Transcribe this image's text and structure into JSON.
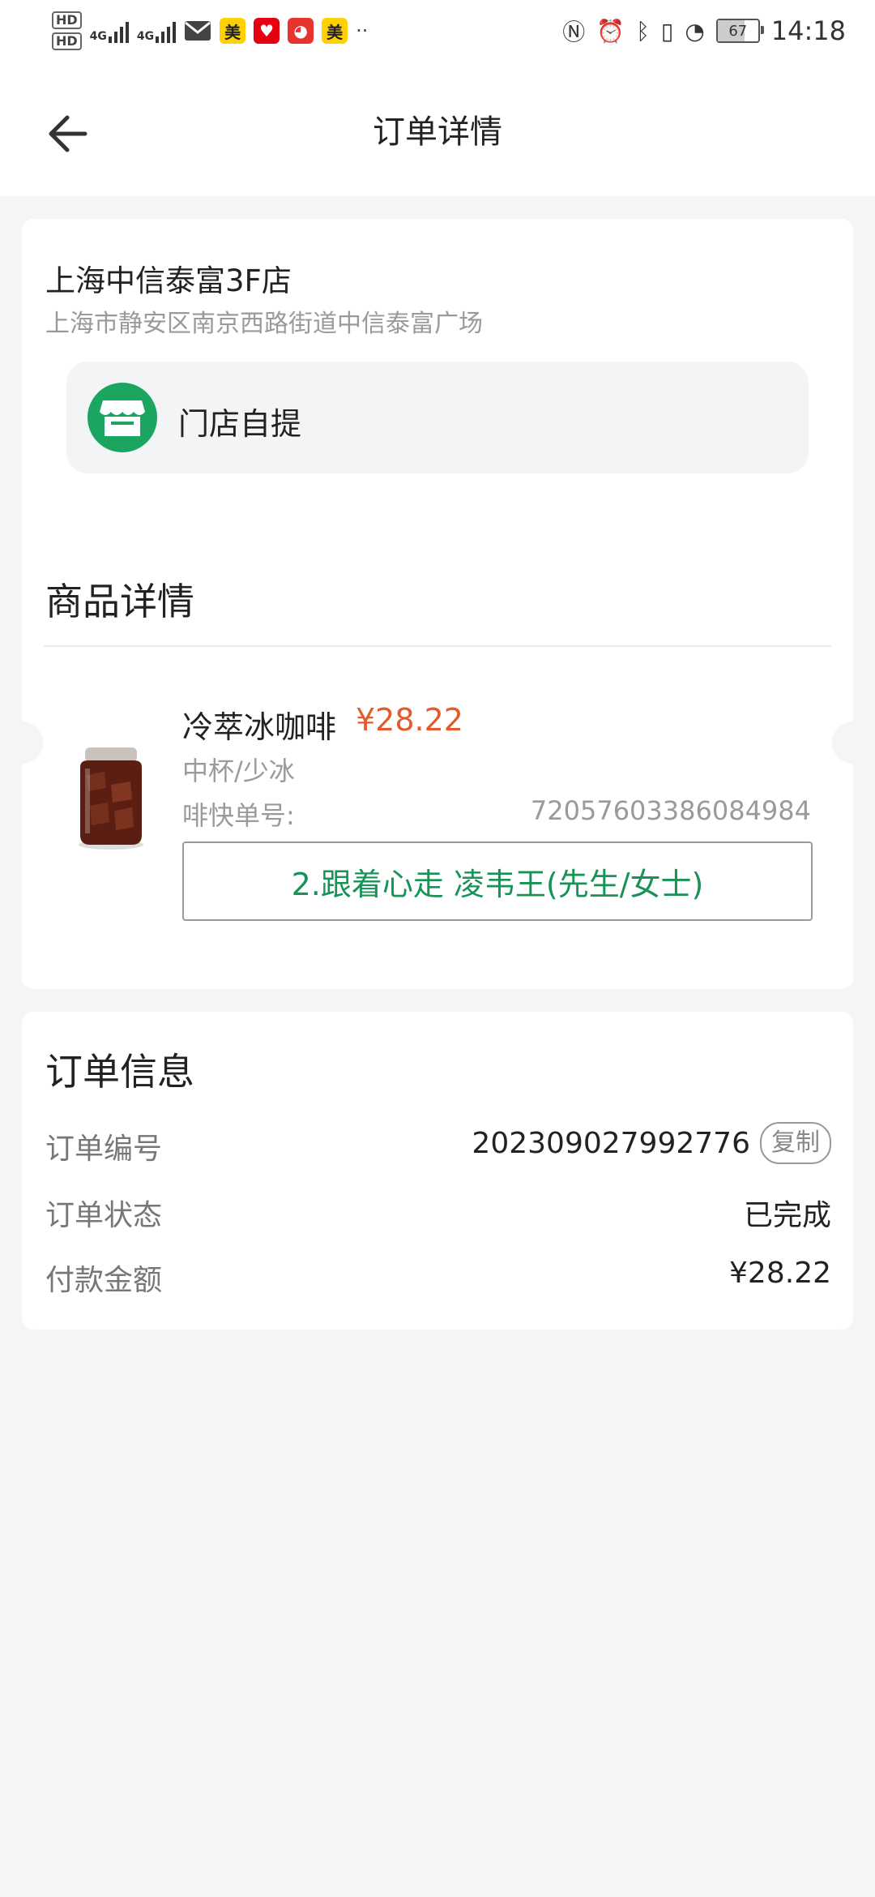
{
  "status_bar": {
    "hd1": "HD",
    "hd2": "HD",
    "net1": "4G",
    "net2": "4G",
    "app_badge_1": "美",
    "app_badge_2": "美",
    "more_dots": "··",
    "battery_level": "67",
    "time": "14:18",
    "icons": [
      "nfc-icon",
      "alarm-icon",
      "bluetooth-icon",
      "vibrate-icon",
      "speed-icon",
      "battery-icon",
      "mail-icon"
    ]
  },
  "header": {
    "title": "订单详情",
    "back_icon": "arrow-left-icon"
  },
  "store": {
    "name": "上海中信泰富3F店",
    "address": "上海市静安区南京西路街道中信泰富广场",
    "pickup_method": "门店自提",
    "pickup_icon": "store-icon",
    "accent_color": "#1aa661"
  },
  "product_section": {
    "title": "商品详情",
    "items": [
      {
        "name": "冷萃冰咖啡",
        "price": "¥28.22",
        "spec": "中杯/少冰",
        "code_label": "啡快单号:",
        "code_value": "72057603386084984",
        "pickup_call": "2.跟着心走 凌韦王(先生/女士)"
      }
    ],
    "price_color": "#e45a2c",
    "call_color": "#179355"
  },
  "order_info": {
    "title": "订单信息",
    "rows": [
      {
        "label": "订单编号",
        "value": "202309027992776",
        "action": "复制"
      },
      {
        "label": "订单状态",
        "value": "已完成"
      },
      {
        "label": "付款金额",
        "value": "¥28.22"
      }
    ]
  }
}
